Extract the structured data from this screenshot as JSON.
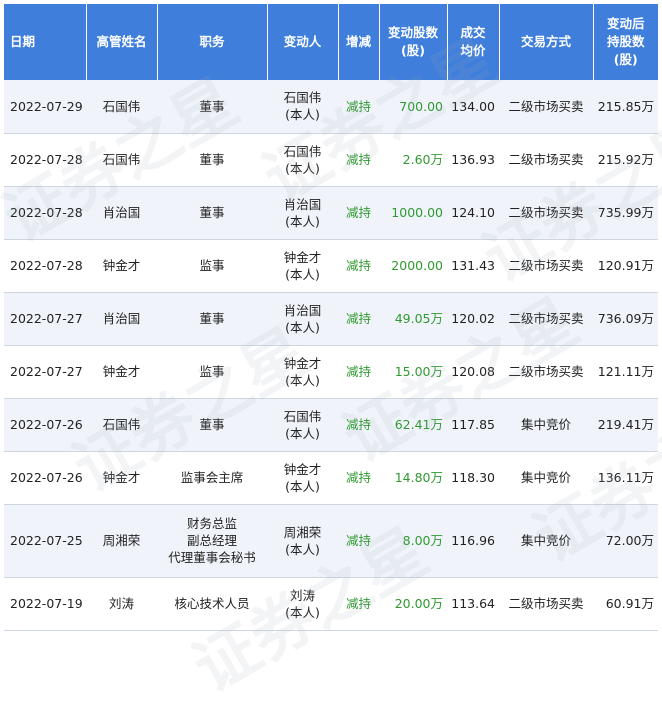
{
  "headers": {
    "date": "日期",
    "name": "高管姓名",
    "position": "职务",
    "changer": "变动人",
    "direction": "增减",
    "change_shares": "变动股数(股)",
    "avg_price": "成交均价",
    "trade_method": "交易方式",
    "after_shares": "变动后持股数(股)"
  },
  "watermark": "证券之星",
  "rows": [
    {
      "date": "2022-07-29",
      "name": "石国伟",
      "position": "董事",
      "changer": "石国伟(本人)",
      "direction": "减持",
      "change": "700.00",
      "price": "134.00",
      "method": "二级市场买卖",
      "after": "215.85万"
    },
    {
      "date": "2022-07-28",
      "name": "石国伟",
      "position": "董事",
      "changer": "石国伟(本人)",
      "direction": "减持",
      "change": "2.60万",
      "price": "136.93",
      "method": "二级市场买卖",
      "after": "215.92万"
    },
    {
      "date": "2022-07-28",
      "name": "肖治国",
      "position": "董事",
      "changer": "肖治国(本人)",
      "direction": "减持",
      "change": "1000.00",
      "price": "124.10",
      "method": "二级市场买卖",
      "after": "735.99万"
    },
    {
      "date": "2022-07-28",
      "name": "钟金才",
      "position": "监事",
      "changer": "钟金才(本人)",
      "direction": "减持",
      "change": "2000.00",
      "price": "131.43",
      "method": "二级市场买卖",
      "after": "120.91万"
    },
    {
      "date": "2022-07-27",
      "name": "肖治国",
      "position": "董事",
      "changer": "肖治国(本人)",
      "direction": "减持",
      "change": "49.05万",
      "price": "120.02",
      "method": "二级市场买卖",
      "after": "736.09万"
    },
    {
      "date": "2022-07-27",
      "name": "钟金才",
      "position": "监事",
      "changer": "钟金才(本人)",
      "direction": "减持",
      "change": "15.00万",
      "price": "120.08",
      "method": "二级市场买卖",
      "after": "121.11万"
    },
    {
      "date": "2022-07-26",
      "name": "石国伟",
      "position": "董事",
      "changer": "石国伟(本人)",
      "direction": "减持",
      "change": "62.41万",
      "price": "117.85",
      "method": "集中竞价",
      "after": "219.41万"
    },
    {
      "date": "2022-07-26",
      "name": "钟金才",
      "position": "监事会主席",
      "changer": "钟金才(本人)",
      "direction": "减持",
      "change": "14.80万",
      "price": "118.30",
      "method": "集中竞价",
      "after": "136.11万"
    },
    {
      "date": "2022-07-25",
      "name": "周湘荣",
      "position": "财务总监\n副总经理\n代理董事会秘书",
      "changer": "周湘荣(本人)",
      "direction": "减持",
      "change": "8.00万",
      "price": "116.96",
      "method": "集中竞价",
      "after": "72.00万"
    },
    {
      "date": "2022-07-19",
      "name": "刘涛",
      "position": "核心技术人员",
      "changer": "刘涛(本人)",
      "direction": "减持",
      "change": "20.00万",
      "price": "113.64",
      "method": "二级市场买卖",
      "after": "60.91万"
    }
  ]
}
